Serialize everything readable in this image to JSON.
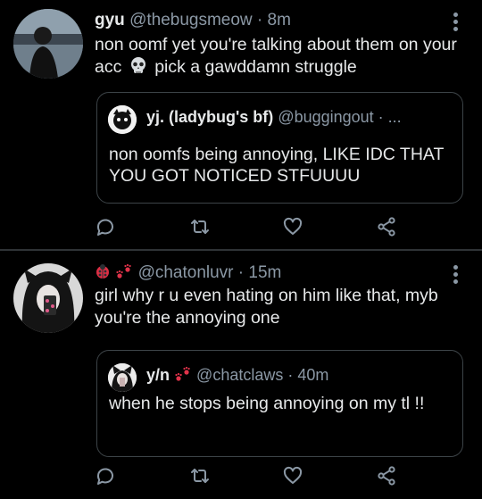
{
  "tweets": [
    {
      "display_name": "gyu",
      "handle_time": "@thebugsmeow · 8m",
      "text_part1": "non oomf yet you're talking about them on your acc",
      "text_part2": "pick a gawddamn struggle",
      "emoji_icon": "skull-emoji",
      "quote": {
        "display_name": "yj. (ladybug's bf)",
        "handle_time": "@buggingout · ...",
        "text": "non oomfs being annoying, LIKE IDC THAT YOU GOT NOTICED STFUUUU"
      }
    },
    {
      "display_name_icons": [
        "ladybug-emoji",
        "paw-prints-emoji"
      ],
      "handle_time": "@chatonluvr · 15m",
      "text": "girl why r u even hating on him like that, myb you're the annoying one",
      "quote": {
        "display_name": "y/n",
        "display_name_icons": [
          "paw-prints-emoji"
        ],
        "handle_time": "@chatclaws · 40m",
        "text": "when he stops being annoying on my tl !!"
      }
    }
  ],
  "actions": [
    "reply-icon",
    "retweet-icon",
    "like-icon",
    "share-icon"
  ],
  "colors": {
    "background": "#000000",
    "text": "#e7e9ea",
    "secondary": "#8b98a5",
    "border": "#3d4448",
    "paw": "#e0334a"
  }
}
